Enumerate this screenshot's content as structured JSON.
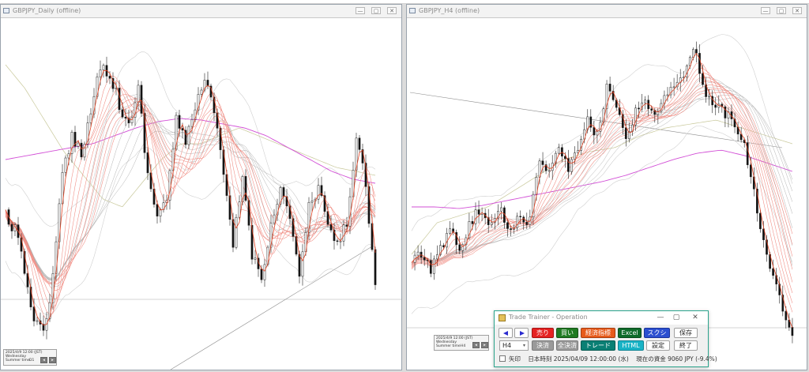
{
  "window_left": {
    "title": "GBPJPY_Daily (offline)",
    "info": {
      "line1": "2025/4/9 12:00 (JST)",
      "line2": "Wednesday",
      "line3": "Summer time",
      "tf": "D1"
    }
  },
  "window_right": {
    "title": "GBPJPY_H4 (offline)",
    "info": {
      "line1": "2025/4/9 12:00 (JST)",
      "line2": "Wednesday",
      "line3": "Summer time",
      "tf": "H4"
    }
  },
  "window_controls": {
    "minimize": "—",
    "restore": "▢",
    "close": "✕"
  },
  "operation": {
    "title": "Trade Trainer - Operation",
    "buttons": {
      "sell": "売り",
      "buy": "買い",
      "indicators": "経済指標",
      "excel": "Excel",
      "screenshot": "スクショ",
      "save": "保存",
      "settle": "決済",
      "settle_all": "全決済",
      "trade": "トレード",
      "html": "HTML",
      "settings": "設定",
      "exit": "終了"
    },
    "timeframe": "H4",
    "arrow_label": "矢印",
    "jp_time_label": "日本時刻",
    "datetime": "2025/04/09 12:00:00 (水)",
    "funds_label": "現在の資金",
    "funds_value": "9060 JPY (-9.4%)"
  },
  "colors": {
    "sell": "#e52222",
    "buy": "#1f7b22",
    "accent_border": "#2ca58d",
    "ma_pink": "#f08a80",
    "ma_gray": "#b4b4b4",
    "ma_magenta": "#d24fd6",
    "ma_olive": "#c8c89a"
  }
}
